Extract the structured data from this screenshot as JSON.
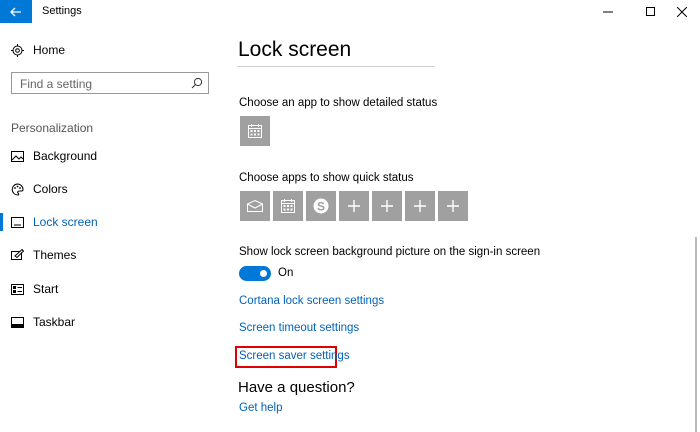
{
  "window": {
    "title": "Settings",
    "controls": [
      "minimize-icon",
      "maximize-icon",
      "close-icon"
    ]
  },
  "sidebar": {
    "home_label": "Home",
    "search_placeholder": "Find a setting",
    "section_title": "Personalization",
    "items": [
      {
        "label": "Background",
        "icon": "background-icon"
      },
      {
        "label": "Colors",
        "icon": "palette-icon"
      },
      {
        "label": "Lock screen",
        "icon": "lock-screen-icon",
        "active": true
      },
      {
        "label": "Themes",
        "icon": "themes-icon"
      },
      {
        "label": "Start",
        "icon": "start-icon"
      },
      {
        "label": "Taskbar",
        "icon": "taskbar-icon"
      }
    ]
  },
  "main": {
    "title": "Lock screen",
    "detailed_status_label": "Choose an app to show detailed status",
    "quick_status_label": "Choose apps to show quick status",
    "quick_status_apps": [
      "mail-icon",
      "calendar-icon",
      "skype-icon",
      "plus-icon",
      "plus-icon",
      "plus-icon",
      "plus-icon"
    ],
    "signin_bg_label": "Show lock screen background picture on the sign-in screen",
    "toggle_state": "On",
    "links": {
      "cortana": "Cortana lock screen settings",
      "timeout": "Screen timeout settings",
      "screensaver": "Screen saver settings"
    },
    "question_heading": "Have a question?",
    "get_help": "Get help"
  },
  "colors": {
    "accent": "#0078d7",
    "tile": "#a0a0a0",
    "link": "#0062b8",
    "highlight": "#e00000"
  }
}
